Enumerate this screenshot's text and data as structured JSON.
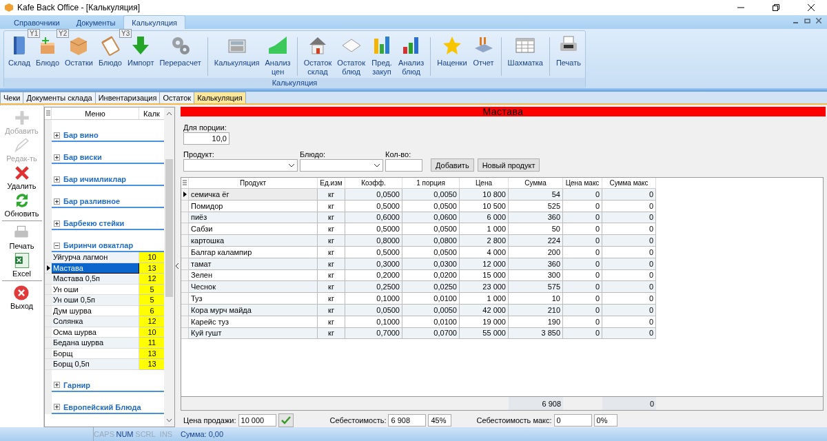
{
  "window": {
    "title": "Kafe Back Office - [Калькуляция]"
  },
  "ribbon": {
    "tabs": [
      {
        "label": "Справочники",
        "selected": false
      },
      {
        "label": "Документы",
        "selected": false
      },
      {
        "label": "Калькуляция",
        "selected": true
      }
    ],
    "group": "Калькуляция",
    "sections": [
      [
        {
          "label": "Склад"
        },
        {
          "label": "Блюдо",
          "keytip": "Y1"
        },
        {
          "label": "Остатки",
          "keytip": "Y2"
        },
        {
          "label": "Блюдо"
        },
        {
          "label": "Импорт",
          "keytip": "Y3"
        },
        {
          "label": "Перерасчет"
        }
      ],
      [
        {
          "label": "Калькуляция"
        },
        {
          "label": "Анализ цен"
        }
      ],
      [
        {
          "label": "Остаток склад"
        },
        {
          "label": "Остаток блюд"
        },
        {
          "label": "Пред. закуп"
        },
        {
          "label": "Анализ блюд"
        }
      ],
      [
        {
          "label": "Наценки"
        },
        {
          "label": "Отчет"
        }
      ],
      [
        {
          "label": "Шахматка"
        }
      ],
      [
        {
          "label": "Печать"
        }
      ]
    ]
  },
  "doc_tabs": [
    {
      "label": "Чеки",
      "selected": false
    },
    {
      "label": "Документы склада",
      "selected": false
    },
    {
      "label": "Инвентаризация",
      "selected": false
    },
    {
      "label": "Остаток",
      "selected": false
    },
    {
      "label": "Калькуляция",
      "selected": true
    }
  ],
  "toolbar": {
    "sections": [
      [
        {
          "label": "Добавить",
          "disabled": true
        },
        {
          "label": "Редак-ть",
          "disabled": true
        },
        {
          "label": "Удалить",
          "disabled": false
        },
        {
          "label": "Обновить",
          "disabled": false
        }
      ],
      [
        {
          "label": "Печать",
          "disabled": false
        },
        {
          "label": "Excel",
          "disabled": false
        }
      ],
      [
        {
          "label": "Выход",
          "disabled": false
        }
      ]
    ]
  },
  "menu": {
    "columns": [
      "Меню",
      "Калк"
    ],
    "groups": [
      {
        "name": "Бар вино",
        "expanded": false
      },
      {
        "name": "Бар виски",
        "expanded": false
      },
      {
        "name": "Бар ичимликлар",
        "expanded": false
      },
      {
        "name": "Бар разливное",
        "expanded": false
      },
      {
        "name": "Барбекю стейки",
        "expanded": false
      },
      {
        "name": "Биринчи овкатлар",
        "expanded": true,
        "items": [
          {
            "name": "Уйгурча лагмон",
            "calc": "10",
            "selected": false
          },
          {
            "name": "Мастава",
            "calc": "13",
            "selected": true
          },
          {
            "name": "Мастава 0,5п",
            "calc": "12",
            "selected": false
          },
          {
            "name": "Ун оши",
            "calc": "5",
            "selected": false
          },
          {
            "name": "Ун оши 0,5п",
            "calc": "5",
            "selected": false
          },
          {
            "name": "Дум шурва",
            "calc": "6",
            "selected": false
          },
          {
            "name": "Солянка",
            "calc": "12",
            "selected": false
          },
          {
            "name": "Осма шурва",
            "calc": "10",
            "selected": false
          },
          {
            "name": "Бедана шурва",
            "calc": "11",
            "selected": false
          },
          {
            "name": "Борщ",
            "calc": "13",
            "selected": false
          },
          {
            "name": "Борщ 0,5п",
            "calc": "13",
            "selected": false
          }
        ]
      },
      {
        "name": "Гарнир",
        "expanded": false
      },
      {
        "name": "Европейский Блюда",
        "expanded": false
      }
    ]
  },
  "detail": {
    "title": "Мастава",
    "portion": {
      "label": "Для порции:",
      "value": "10,0"
    },
    "product": {
      "label": "Продукт:"
    },
    "dish": {
      "label": "Блюдо:"
    },
    "qty": {
      "label": "Кол-во:"
    },
    "buttons": [
      "Добавить",
      "Новый продукт"
    ],
    "table": {
      "columns": [
        "Продукт",
        "Ед.изм",
        "Коэфф.",
        "1 порция",
        "Цена",
        "Сумма",
        "Цена макс",
        "Сумма макс"
      ],
      "rows": [
        {
          "selected": true,
          "cells": [
            "семичка ёг",
            "кг",
            "0,0500",
            "0,0050",
            "10 800",
            "54",
            "0",
            "0"
          ]
        },
        {
          "selected": false,
          "cells": [
            "Помидор",
            "кг",
            "0,5000",
            "0,0500",
            "10 500",
            "525",
            "0",
            "0"
          ]
        },
        {
          "selected": false,
          "cells": [
            "пиёз",
            "кг",
            "0,6000",
            "0,0600",
            "6 000",
            "360",
            "0",
            "0"
          ]
        },
        {
          "selected": false,
          "cells": [
            "Сабзи",
            "кг",
            "0,5000",
            "0,0500",
            "1 000",
            "50",
            "0",
            "0"
          ]
        },
        {
          "selected": false,
          "cells": [
            "картошка",
            "кг",
            "0,8000",
            "0,0800",
            "2 800",
            "224",
            "0",
            "0"
          ]
        },
        {
          "selected": false,
          "cells": [
            "Балгар калампир",
            "кг",
            "0,5000",
            "0,0500",
            "4 000",
            "200",
            "0",
            "0"
          ]
        },
        {
          "selected": false,
          "cells": [
            "тамат",
            "кг",
            "0,3000",
            "0,0300",
            "12 000",
            "360",
            "0",
            "0"
          ]
        },
        {
          "selected": false,
          "cells": [
            "Зелен",
            "кг",
            "0,2000",
            "0,0200",
            "15 000",
            "300",
            "0",
            "0"
          ]
        },
        {
          "selected": false,
          "cells": [
            "Чеснок",
            "кг",
            "0,2500",
            "0,0250",
            "23 000",
            "575",
            "0",
            "0"
          ]
        },
        {
          "selected": false,
          "cells": [
            "Туз",
            "кг",
            "0,1000",
            "0,0100",
            "1 000",
            "10",
            "0",
            "0"
          ]
        },
        {
          "selected": false,
          "cells": [
            "Кора мурч майда",
            "кг",
            "0,0500",
            "0,0050",
            "42 000",
            "210",
            "0",
            "0"
          ]
        },
        {
          "selected": false,
          "cells": [
            "Карейс туз",
            "кг",
            "0,1000",
            "0,0100",
            "19 000",
            "190",
            "0",
            "0"
          ]
        },
        {
          "selected": false,
          "cells": [
            "Куй гушт",
            "кг",
            "0,7000",
            "0,0700",
            "55 000",
            "3 850",
            "0",
            "0"
          ]
        }
      ],
      "totals": {
        "sum": "6 908",
        "sum_max": "0"
      }
    },
    "sale_price": {
      "label": "Цена продажи:",
      "value": "10 000"
    },
    "cost": {
      "label": "Себестоимость:",
      "value": "6 908",
      "percent": "45%"
    },
    "cost_max": {
      "label": "Себестоимость макс:",
      "value": "0",
      "percent": "0%"
    }
  },
  "status_bar": {
    "indicators": [
      {
        "label": "CAPS",
        "on": false
      },
      {
        "label": "NUM",
        "on": true
      },
      {
        "label": "SCRL",
        "on": false
      },
      {
        "label": "INS",
        "on": false
      }
    ],
    "text": "Сумма: 0,00"
  }
}
